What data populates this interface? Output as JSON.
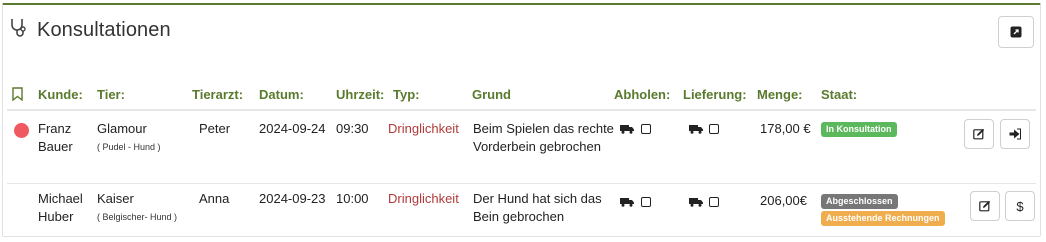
{
  "panel": {
    "title": "Konsultationen",
    "header_icon": "stethoscope-icon",
    "export_icon": "external-link-icon"
  },
  "table": {
    "bookmark_icon": "bookmark-icon",
    "headers": {
      "kunde": "Kunde:",
      "tier": "Tier:",
      "tierarzt": "Tierarzt:",
      "datum": "Datum:",
      "uhrzeit": "Uhrzeit:",
      "typ": "Typ:",
      "grund": "Grund",
      "abholen": "Abholen:",
      "lieferung": "Lieferung:",
      "menge": "Menge:",
      "staat": "Staat:"
    },
    "rows": [
      {
        "status_dot_color": "#f0595f",
        "kunde_line1": "Franz",
        "kunde_line2": "Bauer",
        "tier_name": "Glamour",
        "tier_info": "( Pudel - Hund )",
        "tierarzt": "Peter",
        "datum": "2024-09-24",
        "uhrzeit": "09:30",
        "typ": "Dringlichkeit",
        "grund_line1": "Beim Spielen das rechte",
        "grund_line2": "Vorderbein gebrochen",
        "abholen_checked": false,
        "lieferung_checked": false,
        "menge": "178,00 €",
        "badges": [
          "In Konsultation"
        ],
        "actions": [
          "edit-icon",
          "sign-in-icon"
        ]
      },
      {
        "kunde_line1": "Michael",
        "kunde_line2": "Huber",
        "tier_name": "Kaiser",
        "tier_info": "( Belgischer- Hund )",
        "tierarzt": "Anna",
        "datum": "2024-09-23",
        "uhrzeit": "10:00",
        "typ": "Dringlichkeit",
        "grund_line1": "Der Hund hat sich das",
        "grund_line2": "Bein gebrochen",
        "abholen_checked": false,
        "lieferung_checked": false,
        "menge": "206,00€",
        "badges": [
          "Abgeschlossen",
          "Ausstehende Rechnungen"
        ],
        "actions": [
          "edit-icon",
          "dollar-icon"
        ],
        "dollar_label": "$"
      }
    ]
  },
  "colors": {
    "accent_green": "#5a7a2e",
    "typ_red": "#b23a3a",
    "badge_green": "#5cb85c",
    "badge_gray": "#777777",
    "badge_orange": "#f0ad4e"
  }
}
